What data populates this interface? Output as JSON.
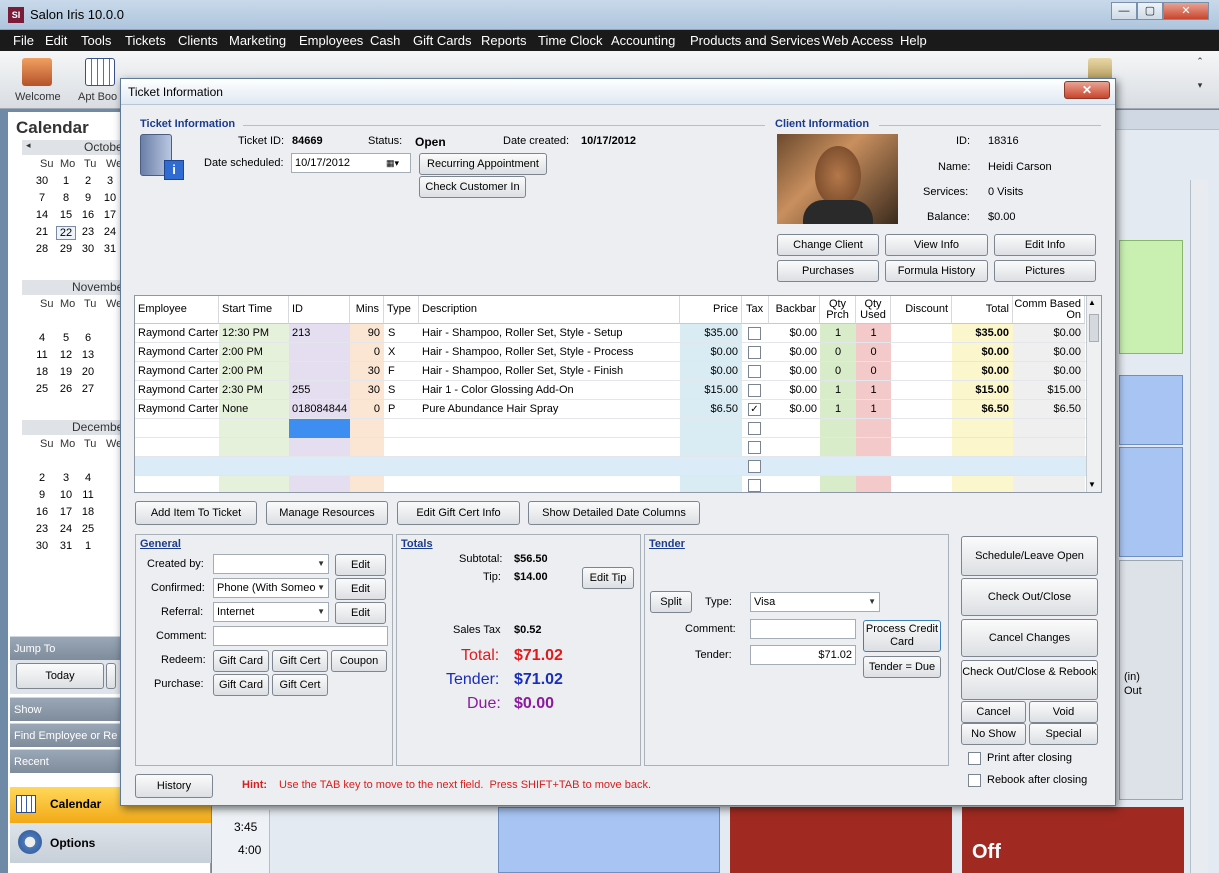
{
  "app": {
    "title": "Salon Iris 10.0.0",
    "logo_text": "SI",
    "menu": [
      "File",
      "Edit",
      "Tools",
      "Tickets",
      "Clients",
      "Marketing",
      "Employees",
      "Cash",
      "Gift Cards",
      "Reports",
      "Time Clock",
      "Accounting",
      "Products and Services",
      "Web Access",
      "Help"
    ],
    "toolbar": {
      "welcome": "Welcome",
      "apt_book": "Apt Boo"
    }
  },
  "left": {
    "calendar_title": "Calendar",
    "months": [
      "October",
      "November",
      "December"
    ],
    "weekdays": [
      "Su",
      "Mo",
      "Tu",
      "We"
    ],
    "october_rows": [
      [
        "30",
        "1",
        "2",
        "3"
      ],
      [
        "7",
        "8",
        "9",
        "10"
      ],
      [
        "14",
        "15",
        "16",
        "17"
      ],
      [
        "21",
        "22",
        "23",
        "24"
      ],
      [
        "28",
        "29",
        "30",
        "31"
      ]
    ],
    "november_rows": [
      [
        "",
        "",
        "",
        ""
      ],
      [
        "4",
        "5",
        "6",
        ""
      ],
      [
        "11",
        "12",
        "13",
        ""
      ],
      [
        "18",
        "19",
        "20",
        ""
      ],
      [
        "25",
        "26",
        "27",
        ""
      ]
    ],
    "december_rows": [
      [
        "",
        "",
        "",
        ""
      ],
      [
        "2",
        "3",
        "4",
        ""
      ],
      [
        "9",
        "10",
        "11",
        ""
      ],
      [
        "16",
        "17",
        "18",
        ""
      ],
      [
        "23",
        "24",
        "25",
        ""
      ],
      [
        "30",
        "31",
        "1",
        ""
      ]
    ],
    "jump_to": "Jump To",
    "today": "Today",
    "show": "Show",
    "find": "Find Employee or Re",
    "recent": "Recent",
    "calendar_btn": "Calendar",
    "options_btn": "Options"
  },
  "schedule": {
    "t1": "3:45",
    "t2": "4:00",
    "off": "Off",
    "frag1": "(in)",
    "frag2": "Out"
  },
  "dialog": {
    "title": "Ticket Information",
    "close": "✕",
    "ticket": {
      "section": "Ticket Information",
      "ticket_id_label": "Ticket ID:",
      "ticket_id": "84669",
      "status_label": "Status:",
      "status": "Open",
      "created_label": "Date created:",
      "created": "10/17/2012",
      "scheduled_label": "Date scheduled:",
      "scheduled": "10/17/2012",
      "recurring_btn": "Recurring Appointment",
      "check_in_btn": "Check Customer In"
    },
    "client": {
      "section": "Client Information",
      "id_label": "ID:",
      "id": "18316",
      "name_label": "Name:",
      "name": "Heidi Carson",
      "services_label": "Services:",
      "services": "0 Visits",
      "balance_label": "Balance:",
      "balance": "$0.00",
      "buttons": [
        "Change Client",
        "View Info",
        "Edit Info",
        "Purchases",
        "Formula History",
        "Pictures"
      ]
    },
    "grid": {
      "headers": [
        "Employee",
        "Start Time",
        "ID",
        "Mins",
        "Type",
        "Description",
        "Price",
        "Tax",
        "Backbar",
        "Qty Prch",
        "Qty Used",
        "Discount",
        "Total",
        "Comm Based On"
      ],
      "rows": [
        {
          "employee": "Raymond Carter",
          "start": "12:30 PM",
          "id": "213",
          "mins": "90",
          "type": "S",
          "desc": "Hair - Shampoo, Roller Set, Style - Setup",
          "price": "$35.00",
          "tax": false,
          "backbar": "$0.00",
          "prch": "1",
          "used": "1",
          "discount": "",
          "total": "$35.00",
          "comm": "$0.00"
        },
        {
          "employee": "Raymond Carter",
          "start": "2:00 PM",
          "id": "",
          "mins": "0",
          "type": "X",
          "desc": "Hair - Shampoo, Roller Set, Style - Process",
          "price": "$0.00",
          "tax": false,
          "backbar": "$0.00",
          "prch": "0",
          "used": "0",
          "discount": "",
          "total": "$0.00",
          "comm": "$0.00"
        },
        {
          "employee": "Raymond Carter",
          "start": "2:00 PM",
          "id": "",
          "mins": "30",
          "type": "F",
          "desc": "Hair - Shampoo, Roller Set, Style - Finish",
          "price": "$0.00",
          "tax": false,
          "backbar": "$0.00",
          "prch": "0",
          "used": "0",
          "discount": "",
          "total": "$0.00",
          "comm": "$0.00"
        },
        {
          "employee": "Raymond Carter",
          "start": "2:30 PM",
          "id": "255",
          "mins": "30",
          "type": "S",
          "desc": "Hair 1 - Color Glossing Add-On",
          "price": "$15.00",
          "tax": false,
          "backbar": "$0.00",
          "prch": "1",
          "used": "1",
          "discount": "",
          "total": "$15.00",
          "comm": "$15.00"
        },
        {
          "employee": "Raymond Carter",
          "start": "None",
          "id": "018084844",
          "mins": "0",
          "type": "P",
          "desc": "Pure Abundance Hair Spray",
          "price": "$6.50",
          "tax": true,
          "backbar": "$0.00",
          "prch": "1",
          "used": "1",
          "discount": "",
          "total": "$6.50",
          "comm": "$6.50"
        }
      ]
    },
    "actions": [
      "Add Item To Ticket",
      "Manage Resources",
      "Edit Gift Cert Info",
      "Show Detailed Date Columns"
    ],
    "general": {
      "title": "General",
      "created_by_label": "Created by:",
      "created_by": "",
      "confirmed_label": "Confirmed:",
      "confirmed": "Phone (With Someo",
      "referral_label": "Referral:",
      "referral": "Internet",
      "comment_label": "Comment:",
      "comment": "",
      "edit": "Edit",
      "redeem_label": "Redeem:",
      "redeem_buttons": [
        "Gift Card",
        "Gift Cert",
        "Coupon"
      ],
      "purchase_label": "Purchase:",
      "purchase_buttons": [
        "Gift Card",
        "Gift Cert"
      ]
    },
    "totals": {
      "title": "Totals",
      "subtotal_label": "Subtotal:",
      "subtotal": "$56.50",
      "tip_label": "Tip:",
      "tip": "$14.00",
      "edit_tip": "Edit Tip",
      "sales_tax_label": "Sales Tax",
      "sales_tax": "$0.52",
      "total_label": "Total:",
      "total": "$71.02",
      "tender_label": "Tender:",
      "tender": "$71.02",
      "due_label": "Due:",
      "due": "$0.00"
    },
    "tender": {
      "title": "Tender",
      "split": "Split",
      "type_label": "Type:",
      "type": "Visa",
      "comment_label": "Comment:",
      "comment": "",
      "tender_label": "Tender:",
      "tender": "$71.02",
      "process": "Process Credit Card",
      "tender_due": "Tender = Due"
    },
    "right_buttons": {
      "schedule": "Schedule/Leave Open",
      "checkout": "Check Out/Close",
      "cancel_changes": "Cancel Changes",
      "checkout_rebook": "Check Out/Close & Rebook",
      "cancel": "Cancel",
      "void": "Void",
      "no_show": "No Show",
      "special": "Special",
      "print_after": "Print after closing",
      "rebook_after": "Rebook after closing"
    },
    "footer": {
      "history": "History",
      "hint_label": "Hint:",
      "hint": "Use the TAB key to move to the next field.  Press SHIFT+TAB to move back."
    }
  }
}
